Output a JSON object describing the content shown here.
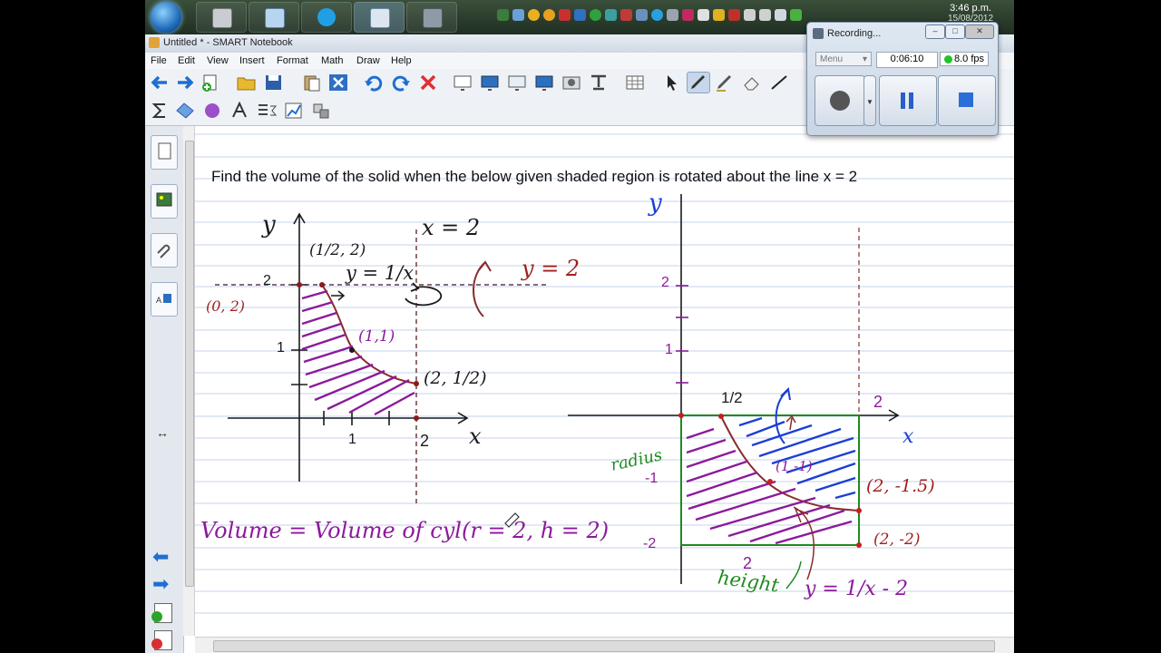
{
  "taskbar": {
    "clock_time": "3:46 p.m.",
    "clock_date": "15/08/2012"
  },
  "window": {
    "title": "Untitled * - SMART Notebook"
  },
  "menu": [
    "File",
    "Edit",
    "View",
    "Insert",
    "Format",
    "Math",
    "Draw",
    "Help"
  ],
  "recorder": {
    "title": "Recording...",
    "menu_label": "Menu",
    "elapsed": "0:06:10",
    "fps": "8.0 fps"
  },
  "question": "Find the volume of the solid when the below given shaded region is rotated about the line x = 2",
  "handwriting": {
    "left": {
      "y_axis": "y",
      "x_axis": "x",
      "line_label": "x = 2",
      "pt_half_two": "(1/2, 2)",
      "curve": "y = 1/x",
      "pt_zero_two": "(0, 2)",
      "pt_one_one": "(1,1)",
      "pt_two_half": "(2, 1/2)",
      "y2": "y = 2",
      "tick_2": "2",
      "tick_1": "1",
      "x_1": "1",
      "x_2": "2"
    },
    "right": {
      "y_axis": "y",
      "x_axis": "x",
      "y_2": "2",
      "y_1": "1",
      "y_neg1": "-1",
      "y_neg2": "-2",
      "x_half": "1/2",
      "x_2": "2",
      "radius": "radius",
      "pt_one_neg_one": "(1,-1)",
      "pt_two_neg_one_five": "(2, -1.5)",
      "pt_two_neg_two": "(2, -2)",
      "height": "height",
      "height_value": "2",
      "curve": "y = 1/x - 2"
    },
    "volume": "Volume = Volume of cyl(r = 2, h = 2)"
  },
  "colors": {
    "ink_black": "#1a1a1a",
    "ink_purple": "#8b1a9b",
    "ink_red": "#a02020",
    "ink_green": "#1f8a1f",
    "ink_blue": "#1a3fd6",
    "grid_line": "#c5d3ee",
    "curve_brown": "#8b2b2b"
  }
}
